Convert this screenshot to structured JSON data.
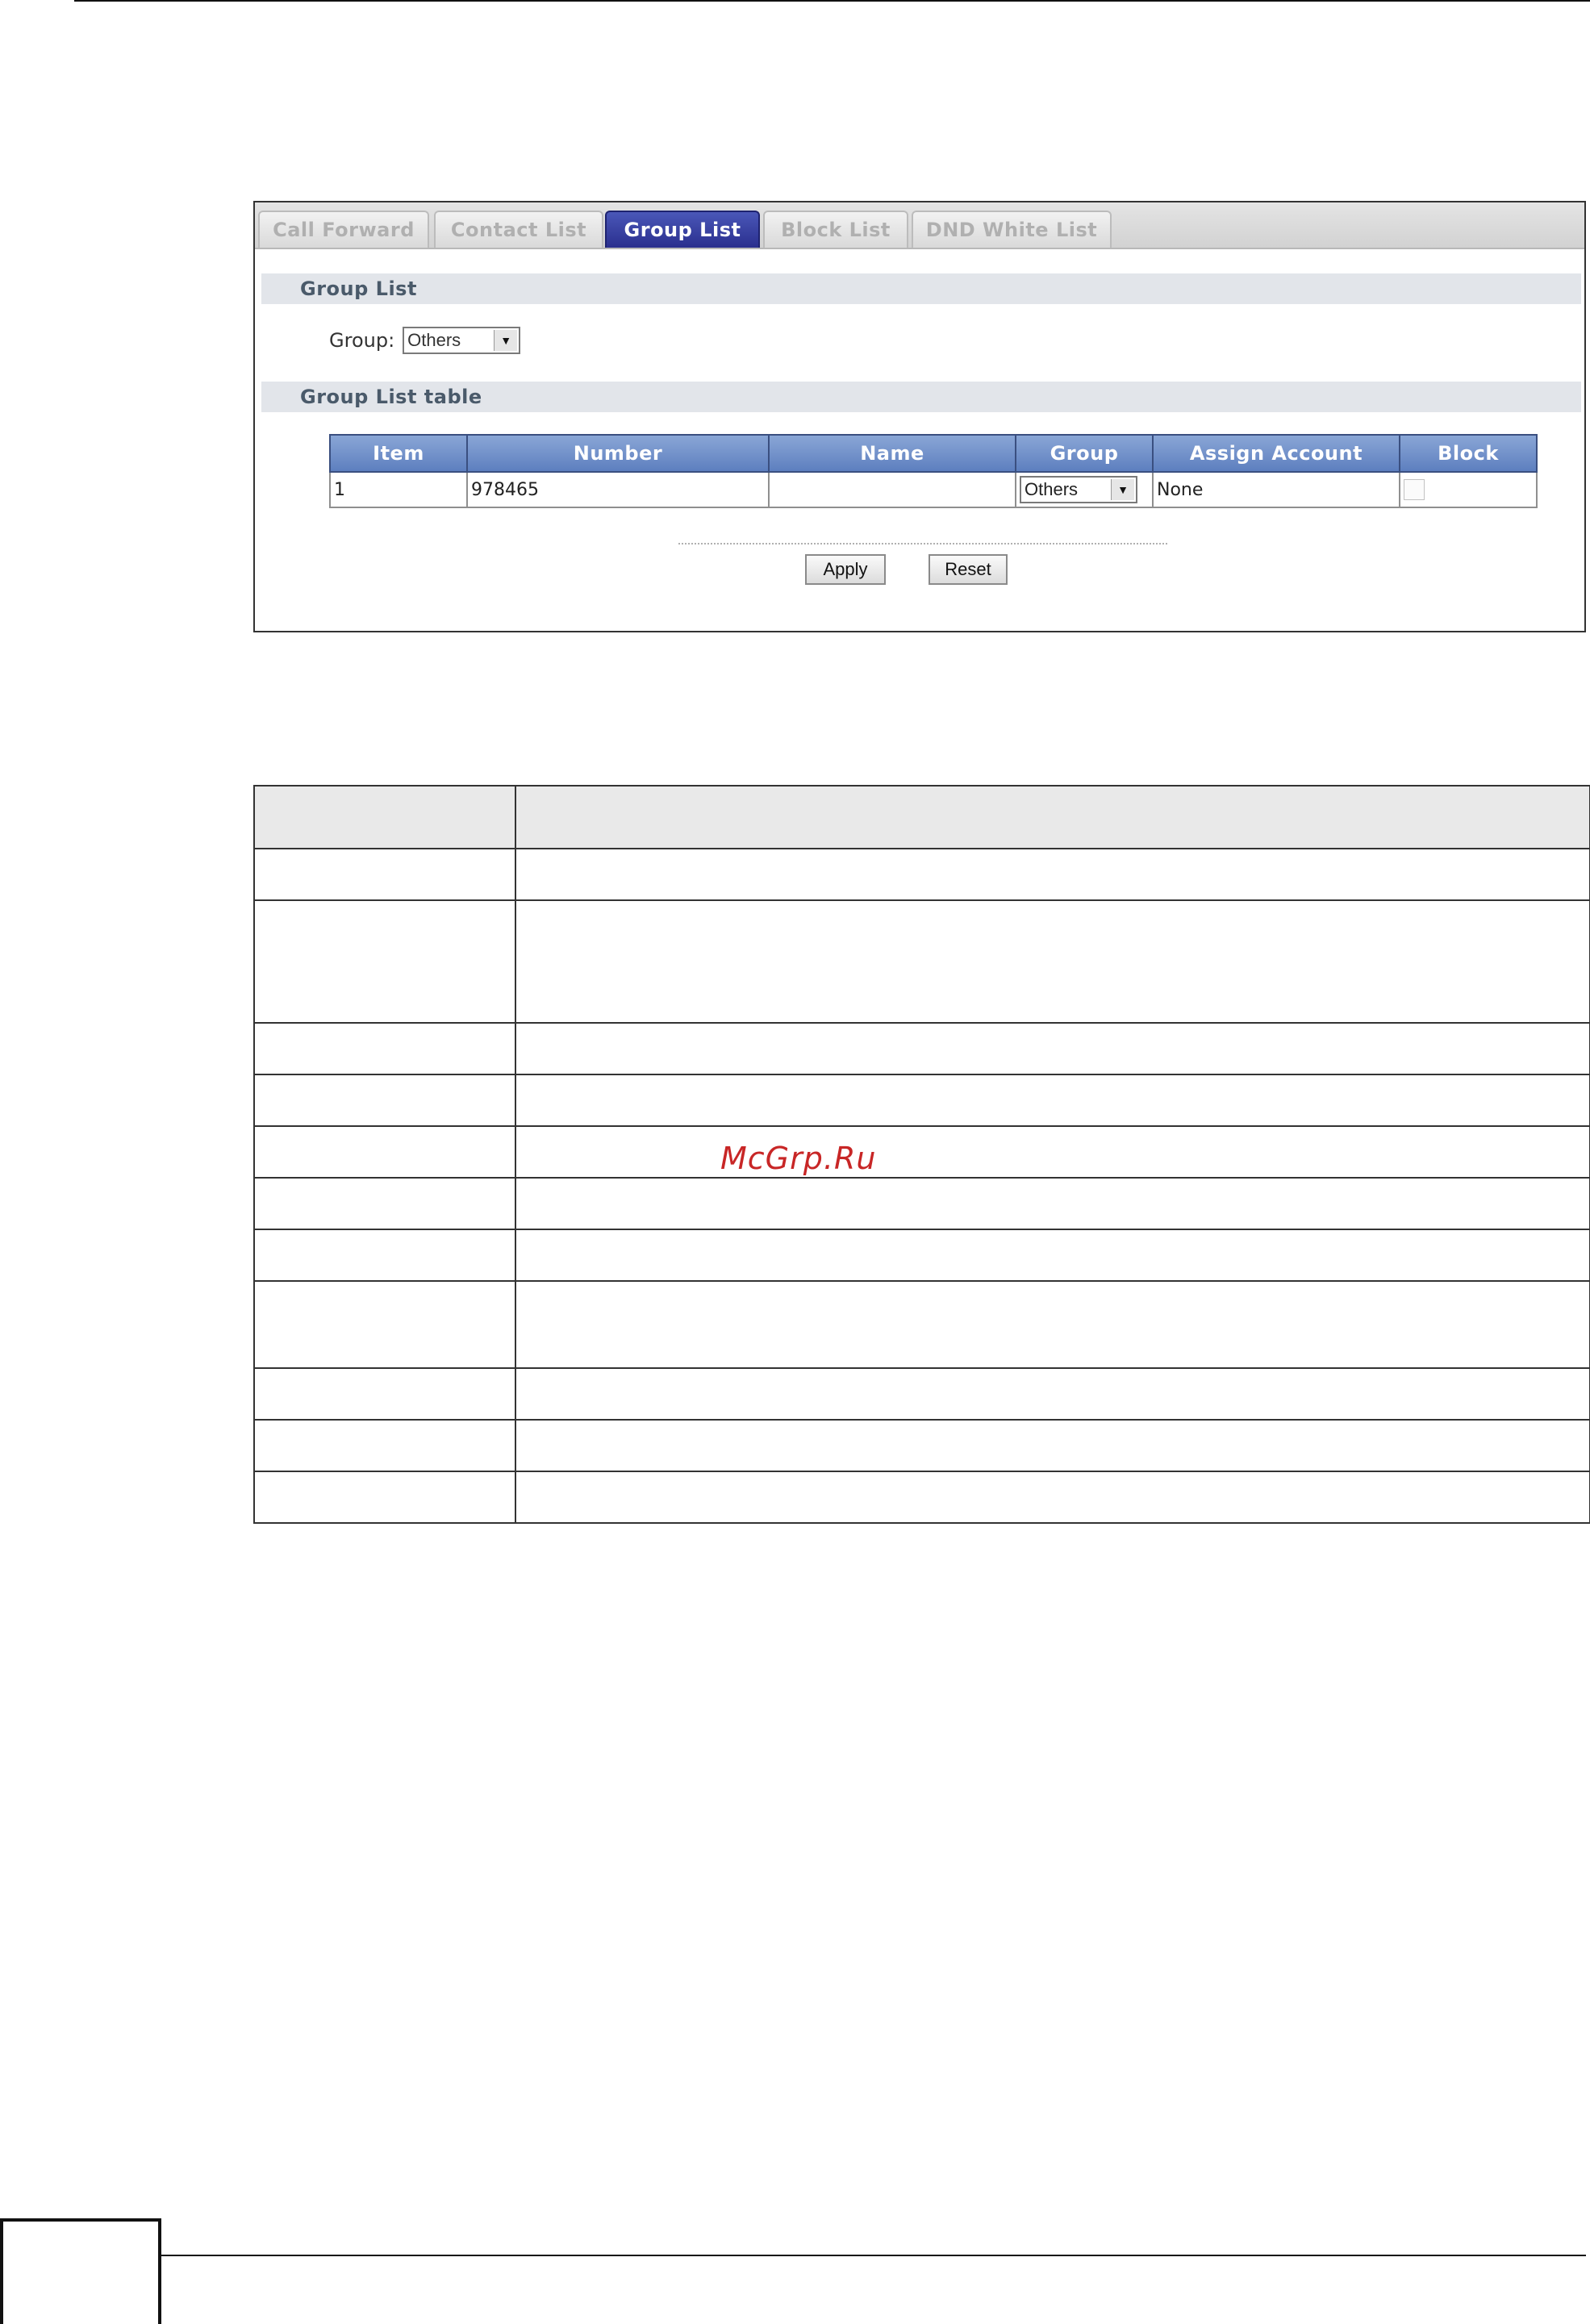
{
  "tabs": [
    {
      "label": "Call Forward",
      "active": false
    },
    {
      "label": "Contact List",
      "active": false
    },
    {
      "label": "Group List",
      "active": true
    },
    {
      "label": "Block List",
      "active": false
    },
    {
      "label": "DND White List",
      "active": false
    }
  ],
  "group_list": {
    "section_title": "Group List",
    "group_label": "Group:",
    "group_selected": "Others"
  },
  "group_list_table": {
    "section_title": "Group List table",
    "columns": [
      "Item",
      "Number",
      "Name",
      "Group",
      "Assign Account",
      "Block"
    ],
    "rows": [
      {
        "item": "1",
        "number": "978465",
        "name": "",
        "group": "Others",
        "assign_account": "None",
        "block": false
      }
    ]
  },
  "buttons": {
    "apply": "Apply",
    "reset": "Reset"
  },
  "watermark": "McGrp.Ru",
  "colors": {
    "active_tab": "#2a2f8e",
    "table_header": "#6b8ac8",
    "watermark": "#c82626"
  }
}
